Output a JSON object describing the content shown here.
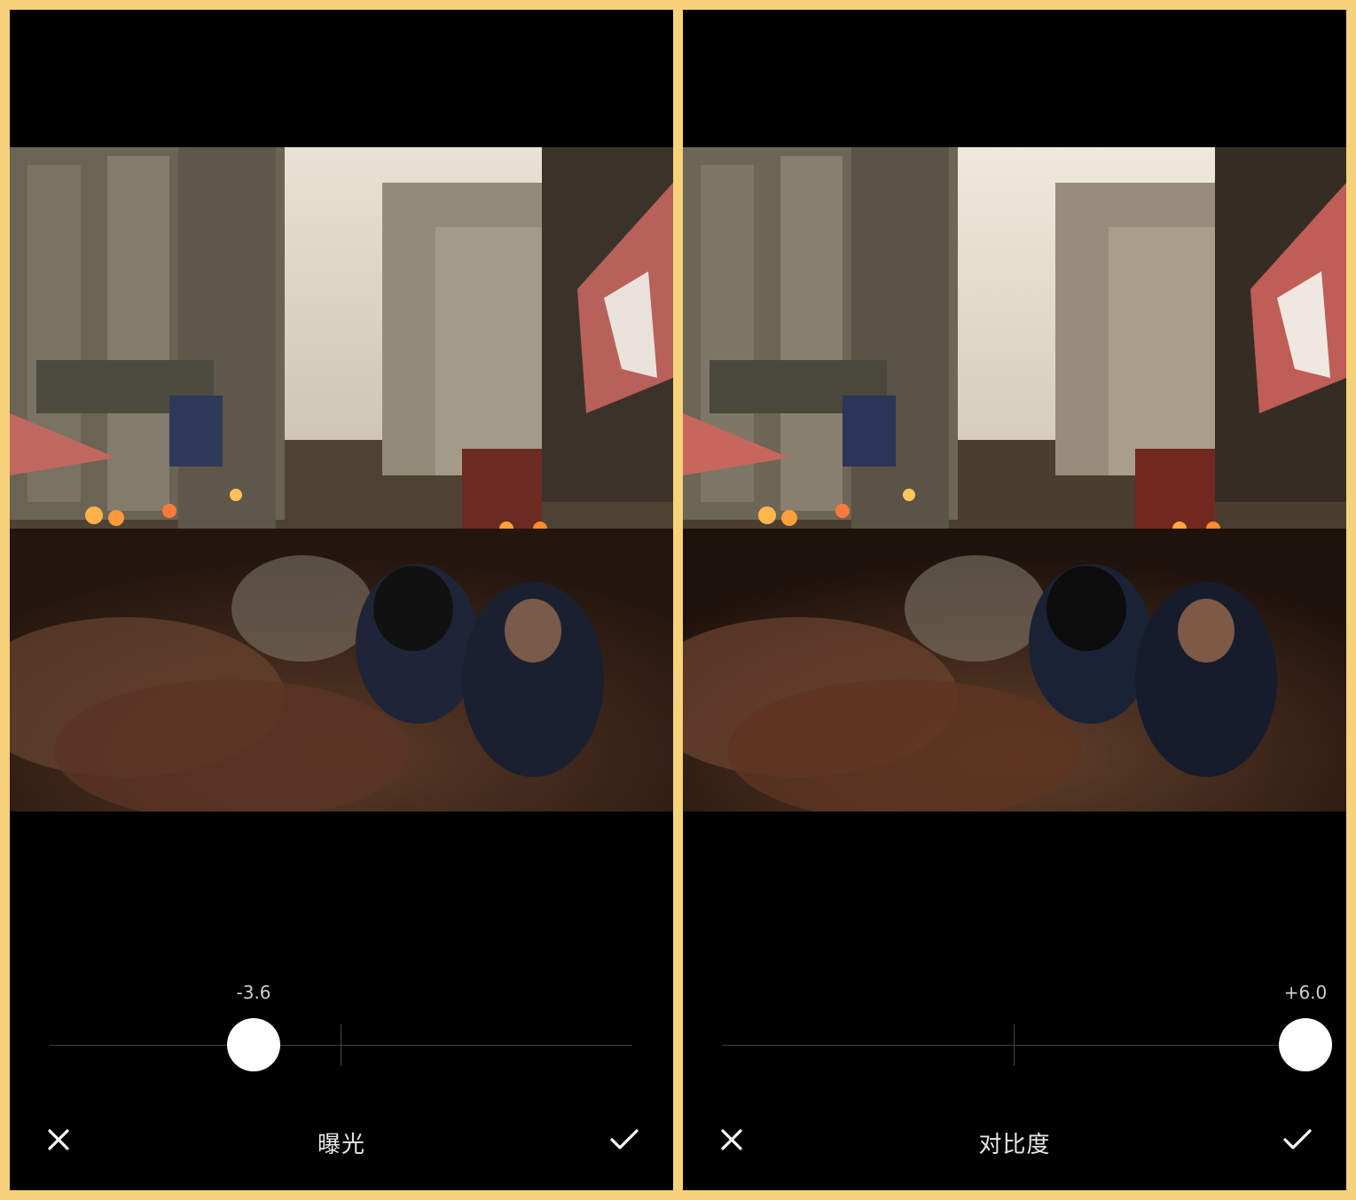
{
  "background_color": "#f6d27a",
  "panels": [
    {
      "tool_name": "曝光",
      "value_label": "-3.6",
      "slider": {
        "min": -12,
        "max": 12,
        "value": -3.6
      },
      "cancel_icon": "close-icon",
      "confirm_icon": "checkmark-icon"
    },
    {
      "tool_name": "对比度",
      "value_label": "+6.0",
      "slider": {
        "min": -6,
        "max": 6,
        "value": 6.0
      },
      "cancel_icon": "close-icon",
      "confirm_icon": "checkmark-icon"
    }
  ]
}
